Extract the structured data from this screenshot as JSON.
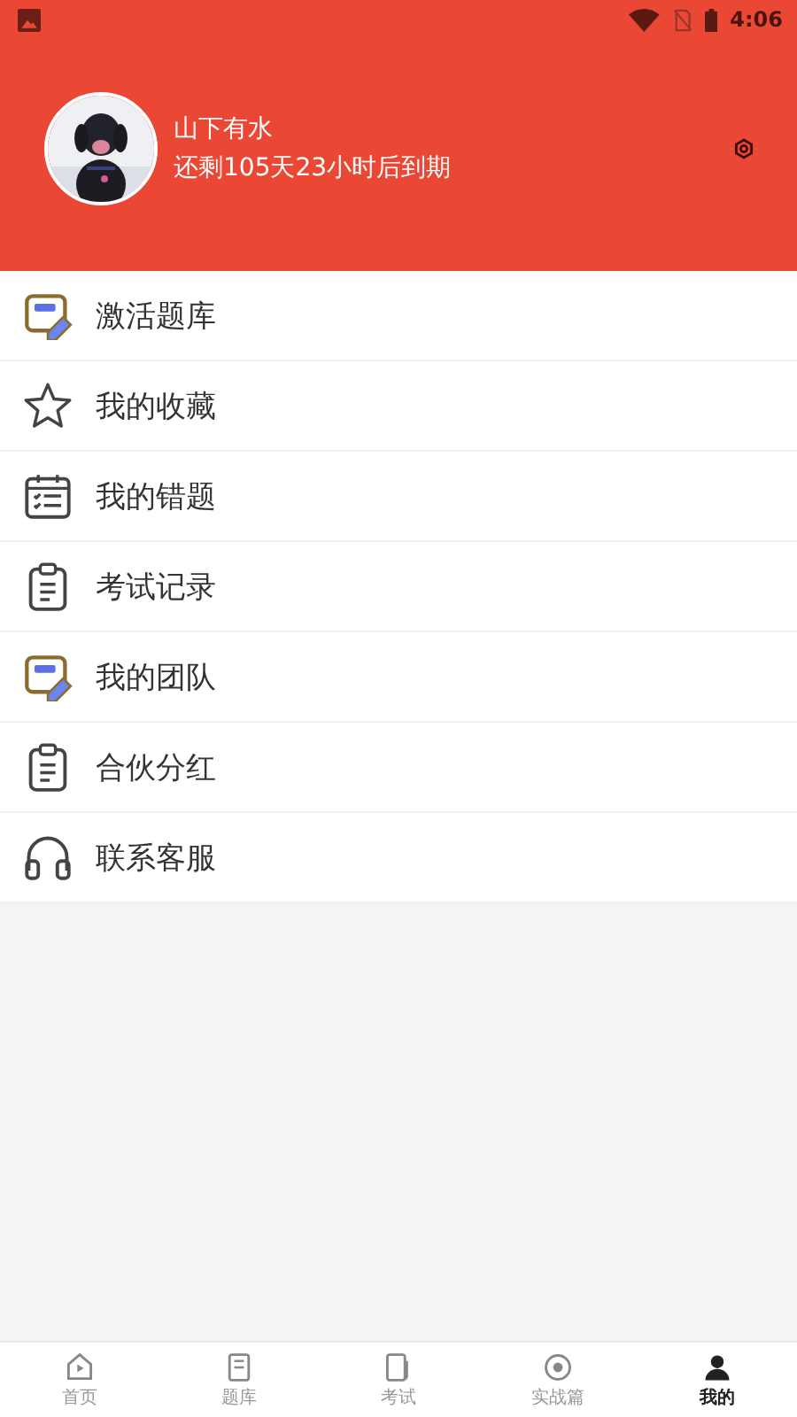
{
  "status_bar": {
    "time": "4:06"
  },
  "profile": {
    "name": "山下有水",
    "expiry": "还剩105天23小时后到期"
  },
  "menu": [
    {
      "label": "激活题库"
    },
    {
      "label": "我的收藏"
    },
    {
      "label": "我的错题"
    },
    {
      "label": "考试记录"
    },
    {
      "label": "我的团队"
    },
    {
      "label": "合伙分红"
    },
    {
      "label": "联系客服"
    }
  ],
  "tab_bar": [
    {
      "label": "首页",
      "selected": false
    },
    {
      "label": "题库",
      "selected": false
    },
    {
      "label": "考试",
      "selected": false
    },
    {
      "label": "实战篇",
      "selected": false
    },
    {
      "label": "我的",
      "selected": true
    }
  ]
}
